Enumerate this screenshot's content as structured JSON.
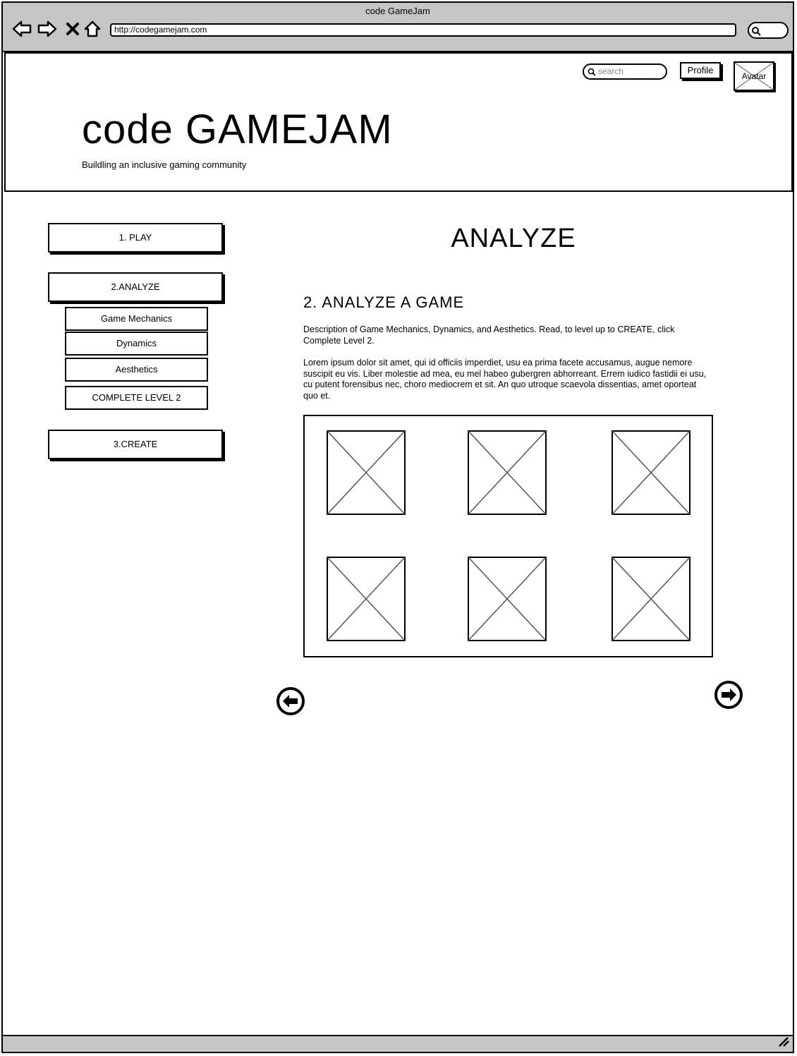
{
  "browser": {
    "window_title": "code GameJam",
    "url": "http://codegamejam.com"
  },
  "header": {
    "search_placeholder": "search",
    "profile_label": "Profile",
    "avatar_label": "Avatar",
    "logo": "code GAMEJAM",
    "tagline": "Buildling an inclusive gaming community"
  },
  "sidebar": {
    "play": "1. PLAY",
    "analyze": "2.ANALYZE",
    "sub_items": [
      "Game Mechanics",
      "Dynamics",
      "Aesthetics",
      "COMPLETE LEVEL 2"
    ],
    "create": "3.CREATE"
  },
  "main": {
    "page_title": "ANALYZE",
    "section_title": "2. ANALYZE A GAME",
    "description": "Description of Game Mechanics, Dynamics, and Aesthetics. Read, to level up to CREATE, click Complete Level 2.",
    "lorem": "Lorem ipsum dolor sit amet, qui id officiis imperdiet, usu ea prima facete accusamus, augue nemore suscipit eu vis. Liber molestie ad mea, eu mel habeo gubergren abhorreant. Errem iudico fastidii ei usu, cu putent forensibus nec, choro mediocrem et sit. An quo utroque scaevola dissentias, amet oporteat quo et.",
    "image_count": 6,
    "prev_icon": "arrow-left-circle-icon",
    "next_icon": "arrow-right-circle-icon"
  }
}
